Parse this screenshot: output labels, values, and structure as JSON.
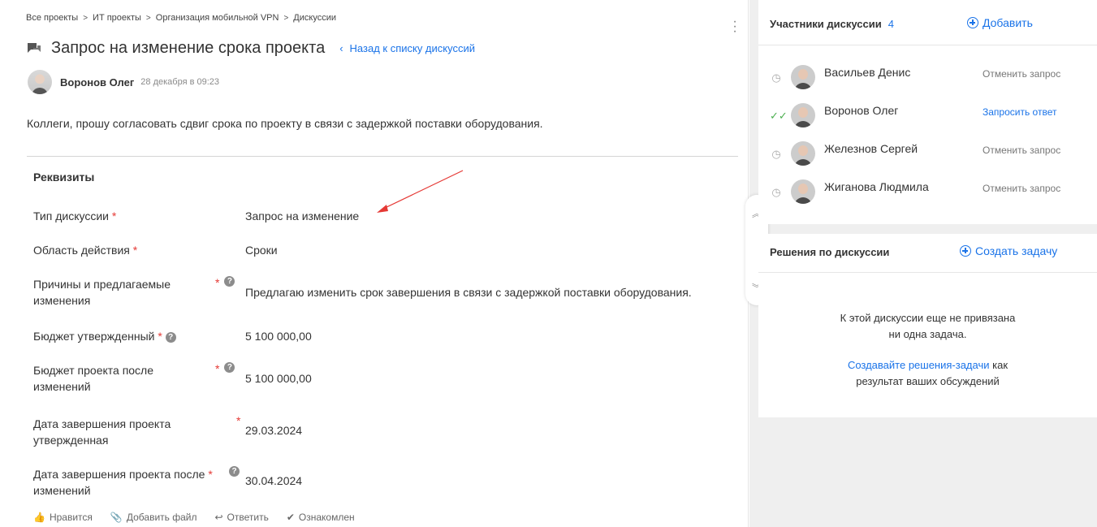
{
  "breadcrumb": [
    "Все проекты",
    "ИТ проекты",
    "Организация мобильной VPN",
    "Дискуссии"
  ],
  "breadcrumb_sep": ">",
  "title": "Запрос на изменение срока проекта",
  "back_link": "Назад к списку дискуссий",
  "author": {
    "name": "Воронов Олег",
    "date": "28 декабря в 09:23"
  },
  "message": "Коллеги, прошу согласовать сдвиг срока по проекту в связи с задержкой поставки оборудования.",
  "props": {
    "title": "Реквизиты",
    "fields": [
      {
        "label": "Тип дискуссии",
        "value": "Запрос на изменение"
      },
      {
        "label": "Область действия",
        "value": "Сроки"
      },
      {
        "label_line1": "Причины и предлагаемые",
        "label_line2": "изменения",
        "value": "Предлагаю изменить срок завершения в связи с задержкой поставки оборудования."
      },
      {
        "label": "Бюджет утвержденный",
        "value": "5 100 000,00"
      },
      {
        "label_line1": "Бюджет проекта после",
        "label_line2": "изменений",
        "value": "5 100 000,00"
      },
      {
        "label_line1": "Дата завершения проекта",
        "label_line2": "утвержденная",
        "value": "29.03.2024"
      },
      {
        "label_line1": "Дата завершения проекта после",
        "label_line2": "изменений",
        "value": "30.04.2024"
      }
    ]
  },
  "required_mark": "*",
  "help_mark": "?",
  "footer": {
    "like": "Нравится",
    "attach": "Добавить файл",
    "reply": "Ответить",
    "ack": "Ознакомлен"
  },
  "participants_panel": {
    "title": "Участники дискуссии",
    "count": "4",
    "add": "Добавить",
    "items": [
      {
        "name": "Васильев Денис",
        "action": "Отменить запрос",
        "status": "pending"
      },
      {
        "name": "Воронов Олег",
        "action": "Запросить ответ",
        "status": "done"
      },
      {
        "name": "Железнов Сергей",
        "action": "Отменить запрос",
        "status": "pending"
      },
      {
        "name": "Жиганова Людмила",
        "action": "Отменить запрос",
        "status": "pending"
      }
    ]
  },
  "decisions_panel": {
    "title": "Решения по дискуссии",
    "create": "Создать задачу",
    "empty_line1": "К этой дискуссии еще не привязана",
    "empty_line2": "ни одна задача.",
    "hint_link": "Создавайте решения-задачи",
    "hint_rest1": " как",
    "hint_line2": "результат ваших обсуждений"
  },
  "colors": {
    "accent": "#1a73e8",
    "required": "#e53935",
    "arrow": "#e53935",
    "ok": "#4caf50"
  }
}
